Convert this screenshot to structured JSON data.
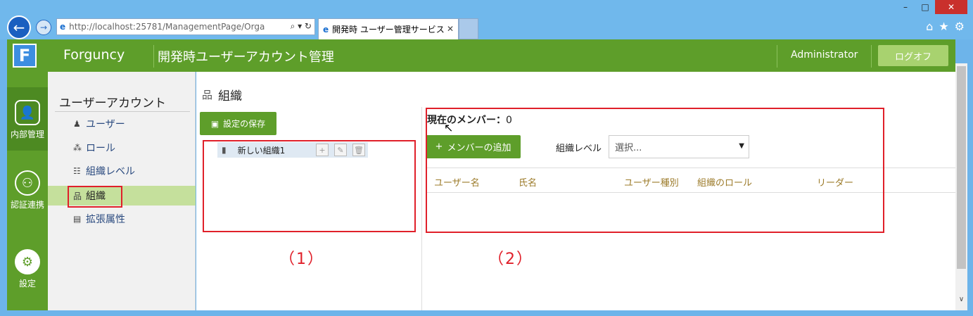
{
  "browser": {
    "url_host": "http://localhost",
    "url_rest": ":25781/ManagementPage/Orga",
    "tab_title": "開発時 ユーザー管理サービス",
    "window_buttons": [
      "–",
      "□",
      "✕"
    ]
  },
  "header": {
    "logo": "F",
    "brand": "Forguncy",
    "title": "開発時ユーザーアカウント管理",
    "user": "Administrator",
    "logoff": "ログオフ"
  },
  "rail": {
    "items": [
      {
        "label": "内部管理",
        "icon": "user-admin-icon"
      },
      {
        "label": "認証連携",
        "icon": "auth-link-icon"
      },
      {
        "label": "設定",
        "icon": "gear-icon"
      }
    ]
  },
  "subnav": {
    "title": "ユーザーアカウント",
    "items": [
      {
        "label": "ユーザー",
        "icon": "person-icon"
      },
      {
        "label": "ロール",
        "icon": "roles-icon"
      },
      {
        "label": "組織レベル",
        "icon": "org-level-icon"
      },
      {
        "label": "組織",
        "icon": "org-icon"
      },
      {
        "label": "拡張属性",
        "icon": "ext-attr-icon"
      }
    ]
  },
  "main": {
    "title": "組織",
    "save_label": "設定の保存",
    "tree_node": "新しい組織1",
    "annotation1": "（1）",
    "annotation2": "（2）",
    "members_label": "現在のメンバー：",
    "members_count": "0",
    "add_member": "メンバーの追加",
    "level_label": "組織レベル",
    "level_placeholder": "選択...",
    "columns": [
      "ユーザー名",
      "氏名",
      "ユーザー種別",
      "組織のロール",
      "リーダー"
    ]
  },
  "colors": {
    "primary_green": "#5e9e2a",
    "active_nav": "#c5e09c",
    "annotation_red": "#e0202a",
    "column_header": "#9c7b2a"
  }
}
